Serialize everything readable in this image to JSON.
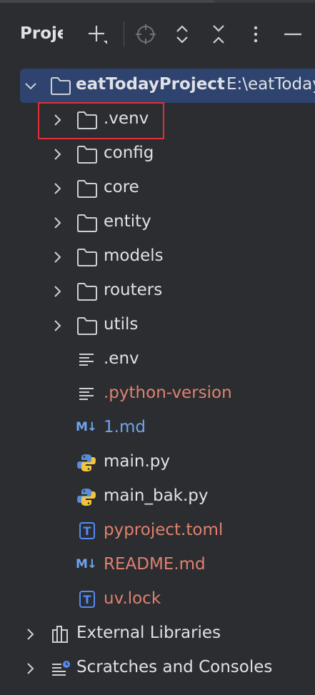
{
  "panel": {
    "title": "Proje",
    "toolbar": {
      "icons": [
        "add-icon",
        "locate-icon",
        "expand-all-icon",
        "collapse-all-icon",
        "more-options-icon",
        "minimize-icon"
      ]
    }
  },
  "tree": {
    "root": {
      "name": "eatTodayProject",
      "path": "E:\\eatToday"
    },
    "items": [
      {
        "name": ".venv",
        "type": "folder"
      },
      {
        "name": "config",
        "type": "folder"
      },
      {
        "name": "core",
        "type": "folder"
      },
      {
        "name": "entity",
        "type": "folder"
      },
      {
        "name": "models",
        "type": "folder"
      },
      {
        "name": "routers",
        "type": "folder"
      },
      {
        "name": "utils",
        "type": "folder"
      },
      {
        "name": ".env",
        "type": "text-file"
      },
      {
        "name": ".python-version",
        "type": "text-file"
      },
      {
        "name": "1.md",
        "type": "markdown-file"
      },
      {
        "name": "main.py",
        "type": "python-file"
      },
      {
        "name": "main_bak.py",
        "type": "python-file"
      },
      {
        "name": "pyproject.toml",
        "type": "toml-file"
      },
      {
        "name": "README.md",
        "type": "markdown-file"
      },
      {
        "name": "uv.lock",
        "type": "lock-file"
      }
    ],
    "external_libraries": "External Libraries",
    "scratches": "Scratches and Consoles"
  },
  "icons": {
    "markdown_badge": "M↓",
    "text_badge": "T"
  },
  "colors": {
    "background": "#2b2d30",
    "selection": "#2e436e",
    "modified_red": "#e0816f",
    "new_blue": "#6fa3f0",
    "highlight_box": "#e0303a"
  }
}
